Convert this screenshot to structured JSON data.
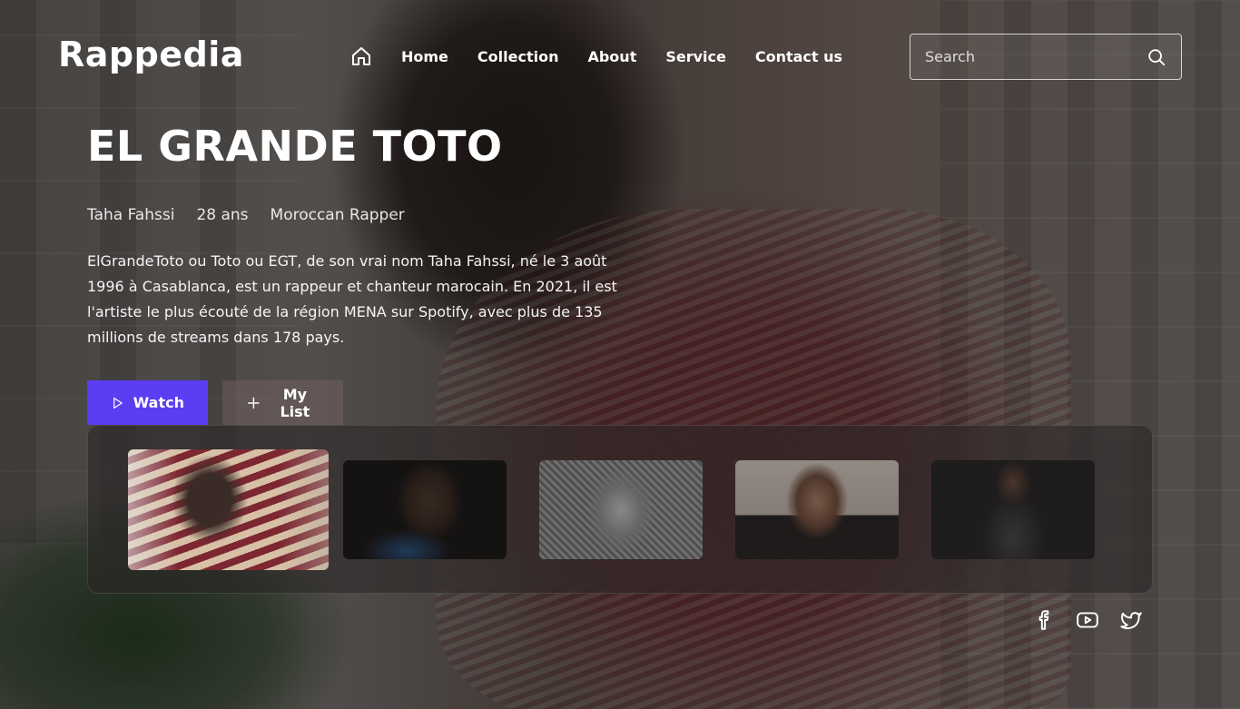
{
  "brand": {
    "logo": "Rappedia"
  },
  "nav": {
    "items": [
      {
        "label": "Home"
      },
      {
        "label": "Collection"
      },
      {
        "label": "About"
      },
      {
        "label": "Service"
      },
      {
        "label": "Contact us"
      }
    ]
  },
  "search": {
    "placeholder": "Search",
    "value": ""
  },
  "hero": {
    "title": "EL GRANDE TOTO",
    "meta": {
      "real_name": "Taha Fahssi",
      "age": "28 ans",
      "role": "Moroccan Rapper"
    },
    "description": "ElGrandeToto ou Toto ou EGT, de son vrai nom Taha Fahssi, né le 3 août 1996 à Casablanca, est un rappeur et chanteur marocain. En 2021, il est l'artiste le plus écouté de la région MENA sur Spotify, avec plus de 135 millions de streams dans 178 pays.",
    "watch_label": "Watch",
    "mylist_label": "My List"
  },
  "carousel": {
    "active_index": 0,
    "thumb_count": 5
  },
  "social": {
    "icons": [
      "facebook-icon",
      "youtube-icon",
      "twitter-icon"
    ]
  },
  "colors": {
    "accent": "#5b3ef2",
    "text": "#ffffff"
  }
}
